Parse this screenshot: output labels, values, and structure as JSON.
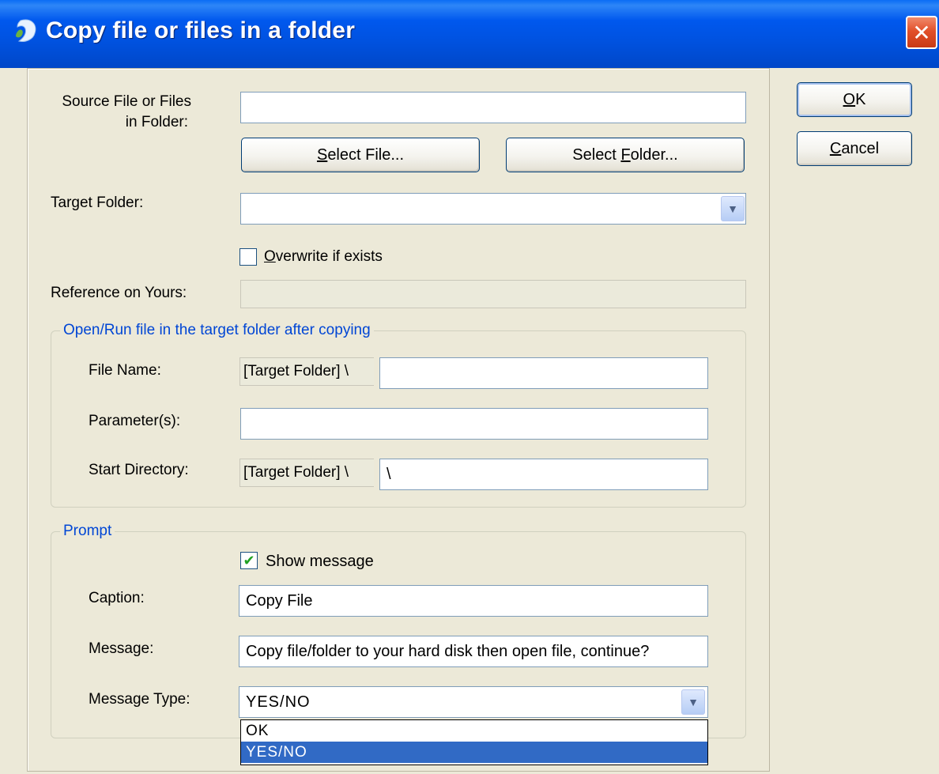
{
  "window": {
    "title": "Copy file or files in a folder",
    "close_glyph": "✕"
  },
  "source": {
    "label_line1": "Source File or Files",
    "label_line2": "in Folder:",
    "value": "",
    "select_file_label_hot": "S",
    "select_file_label_rest": "elect File...",
    "select_folder_label_pre": "Select ",
    "select_folder_label_hot": "F",
    "select_folder_label_rest": "older..."
  },
  "target": {
    "label": "Target Folder:",
    "value": ""
  },
  "overwrite": {
    "label_hot": "O",
    "label_rest": "verwrite if exists",
    "checked": false
  },
  "reference": {
    "label": "Reference on Yours:",
    "value": ""
  },
  "open_run": {
    "group_title": "Open/Run file in the target folder after copying",
    "file_name_label": "File Name:",
    "file_name_prefix": "[Target Folder] \\",
    "file_name_value": "",
    "parameters_label": "Parameter(s):",
    "parameters_value": "",
    "start_dir_label": "Start Directory:",
    "start_dir_prefix": "[Target Folder] \\",
    "start_dir_value": "\\"
  },
  "prompt": {
    "group_title": "Prompt",
    "show_message_label": "Show message",
    "show_message_checked": true,
    "caption_label": "Caption:",
    "caption_value": "Copy File",
    "message_label": "Message:",
    "message_value": "Copy file/folder to your hard disk then open file, continue?",
    "message_type_label": "Message Type:",
    "message_type_value": "YES/NO",
    "message_type_options": [
      "OK",
      "YES/NO"
    ]
  },
  "buttons": {
    "ok_hot": "O",
    "ok_rest": "K",
    "cancel_hot": "C",
    "cancel_rest": "ancel"
  },
  "icons": {
    "check_glyph": "✔",
    "dropdown_glyph": "▼"
  },
  "colors": {
    "titlebar": "#0058ee",
    "group_title": "#0046d5",
    "selection": "#316ac5",
    "dialog_bg": "#ece9d8"
  }
}
